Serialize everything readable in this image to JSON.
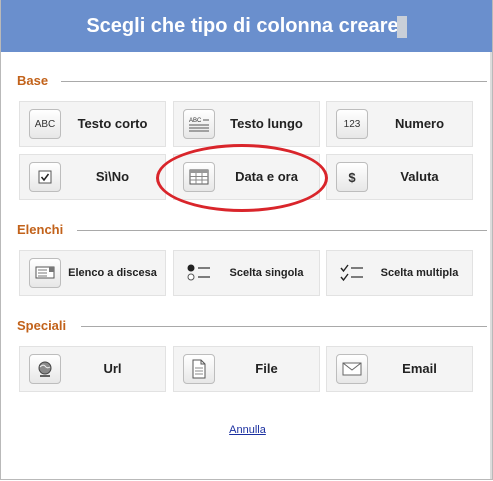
{
  "dialog": {
    "title": "Scegli che tipo di colonna creare",
    "cancel_label": "Annulla"
  },
  "sections": [
    {
      "label": "Base",
      "tiles": [
        {
          "label": "Testo corto",
          "icon": "short-text-icon",
          "icon_text": "ABC"
        },
        {
          "label": "Testo lungo",
          "icon": "long-text-icon"
        },
        {
          "label": "Numero",
          "icon": "number-icon",
          "icon_text": "123"
        },
        {
          "label": "Sì\\No",
          "icon": "checkbox-icon"
        },
        {
          "label": "Data e ora",
          "icon": "calendar-icon"
        },
        {
          "label": "Valuta",
          "icon": "currency-icon",
          "icon_text": "$"
        }
      ]
    },
    {
      "label": "Elenchi",
      "tiles": [
        {
          "label": "Elenco a discesa",
          "icon": "dropdown-list-icon"
        },
        {
          "label": "Scelta singola",
          "icon": "radio-list-icon"
        },
        {
          "label": "Scelta multipla",
          "icon": "checklist-icon"
        }
      ]
    },
    {
      "label": "Speciali",
      "tiles": [
        {
          "label": "Url",
          "icon": "globe-icon"
        },
        {
          "label": "File",
          "icon": "document-icon"
        },
        {
          "label": "Email",
          "icon": "envelope-icon"
        }
      ]
    }
  ],
  "colors": {
    "title_bar": "#6a8fcd",
    "section_label": "#c2621a",
    "annotation_ring": "#d9252b",
    "link": "#1a2fa0"
  }
}
